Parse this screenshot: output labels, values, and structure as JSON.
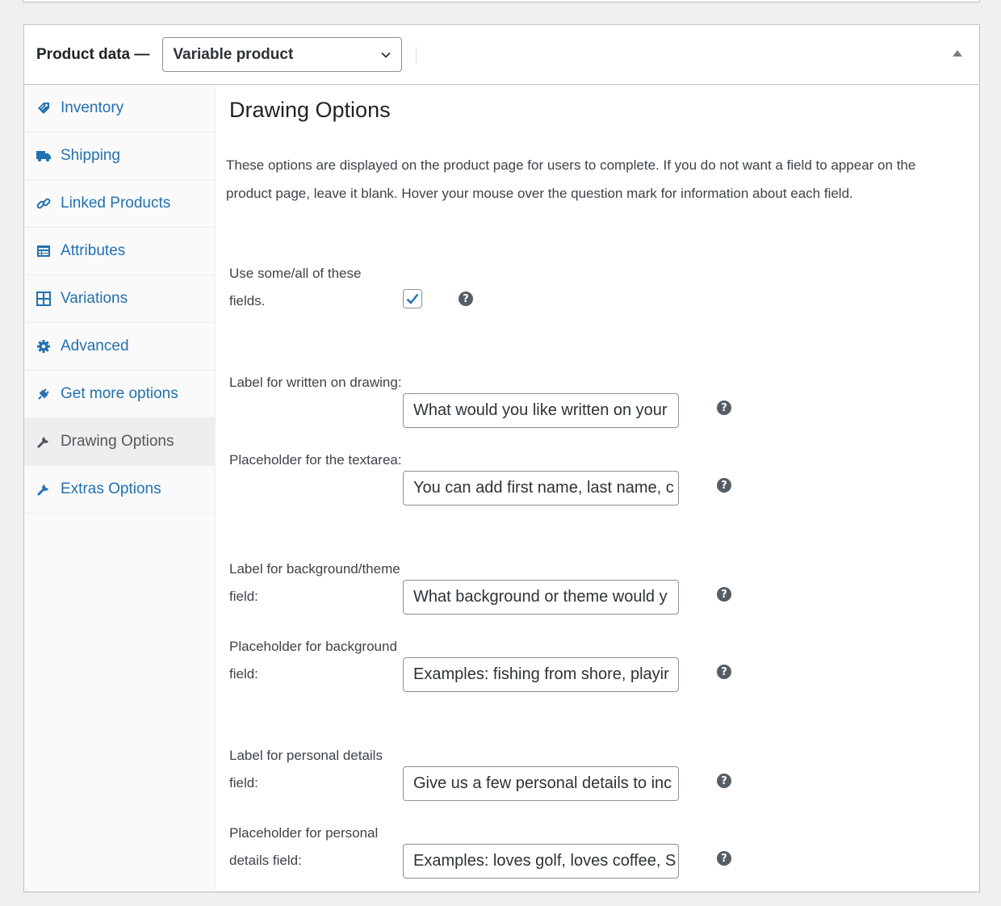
{
  "header": {
    "title": "Product data —",
    "product_type": "Variable product"
  },
  "tabs": [
    {
      "label": "Inventory",
      "icon": "tag-icon"
    },
    {
      "label": "Shipping",
      "icon": "truck-icon"
    },
    {
      "label": "Linked Products",
      "icon": "link-icon"
    },
    {
      "label": "Attributes",
      "icon": "list-icon"
    },
    {
      "label": "Variations",
      "icon": "grid-icon"
    },
    {
      "label": "Advanced",
      "icon": "gear-icon"
    },
    {
      "label": "Get more options",
      "icon": "plugin-icon"
    },
    {
      "label": "Drawing Options",
      "icon": "wrench-icon"
    },
    {
      "label": "Extras Options",
      "icon": "wrench-icon"
    }
  ],
  "panel": {
    "title": "Drawing Options",
    "description": "These options are displayed on the product page for users to complete. If you do not want a field to appear on the product page, leave it blank. Hover your mouse over the question mark for information about each field.",
    "use_fields": {
      "label": "Use some/all of these fields.",
      "checked": true
    },
    "fields": [
      {
        "label": "Label for written on drawing:",
        "value": "What would you like written on your"
      },
      {
        "label": "Placeholder for the textarea:",
        "value": "You can add first name, last name, c"
      },
      {
        "label": "Label for background/theme field:",
        "value": "What background or theme would y"
      },
      {
        "label": "Placeholder for background field:",
        "value": "Examples: fishing from shore, playir"
      },
      {
        "label": "Label for personal details field:",
        "value": "Give us a few personal details to inc"
      },
      {
        "label": "Placeholder for personal details field:",
        "value": "Examples: loves golf, loves coffee, S"
      }
    ],
    "help_glyph": "?"
  },
  "colors": {
    "link": "#2271b1",
    "active_tab_bg": "#eeeeee",
    "checkbox_check": "#2271b1",
    "help_icon": "#555d66"
  }
}
